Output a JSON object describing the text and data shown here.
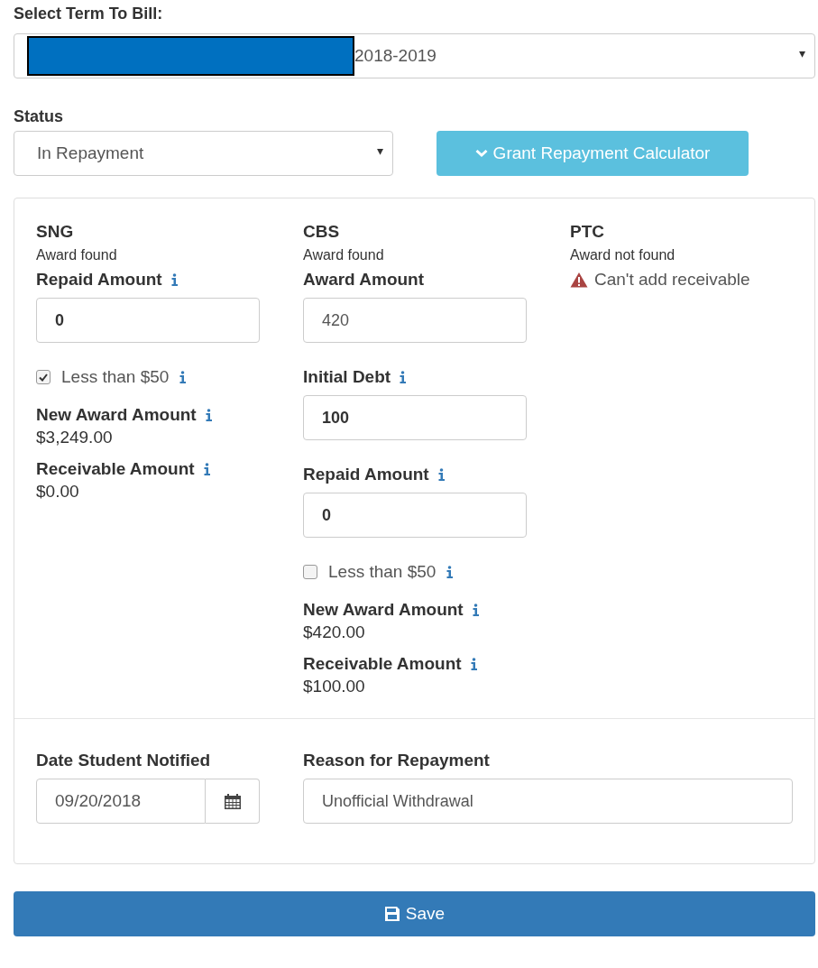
{
  "term": {
    "label": "Select Term To Bill:",
    "value": "2018-2019",
    "redacted": true,
    "caret": "▾"
  },
  "status": {
    "label": "Status",
    "value": "In Repayment",
    "caret": "▾"
  },
  "calculator_button": {
    "label": "Grant Repayment Calculator",
    "expanded": true
  },
  "grants": [
    {
      "name": "SNG",
      "note": "Award found",
      "items": [
        {
          "kind": "field",
          "label": "Repaid Amount",
          "info": true,
          "value": "0",
          "bold": true
        },
        {
          "kind": "checkbox",
          "label": "Less than $50",
          "checked": true,
          "info": true
        },
        {
          "kind": "amount",
          "label": "New Award Amount",
          "info": true,
          "value": "$3,249.00"
        },
        {
          "kind": "amount",
          "label": "Receivable Amount",
          "info": true,
          "value": "$0.00"
        }
      ]
    },
    {
      "name": "CBS",
      "note": "Award found",
      "items": [
        {
          "kind": "field",
          "label": "Award Amount",
          "info": false,
          "value": "420",
          "bold": false
        },
        {
          "kind": "field",
          "label": "Initial Debt",
          "info": true,
          "value": "100",
          "bold": true
        },
        {
          "kind": "field",
          "label": "Repaid Amount",
          "info": true,
          "value": "0",
          "bold": true
        },
        {
          "kind": "checkbox",
          "label": "Less than $50",
          "checked": false,
          "info": true
        },
        {
          "kind": "amount",
          "label": "New Award Amount",
          "info": true,
          "value": "$420.00"
        },
        {
          "kind": "amount",
          "label": "Receivable Amount",
          "info": true,
          "value": "$100.00"
        }
      ]
    },
    {
      "name": "PTC",
      "note": "Award not found",
      "items": [
        {
          "kind": "warning",
          "label": "Can't add receivable"
        }
      ]
    }
  ],
  "date_notified": {
    "label": "Date Student Notified",
    "value": "09/20/2018"
  },
  "reason": {
    "label": "Reason for Repayment",
    "value": "Unofficial Withdrawal"
  },
  "save_button": {
    "label": "Save"
  }
}
